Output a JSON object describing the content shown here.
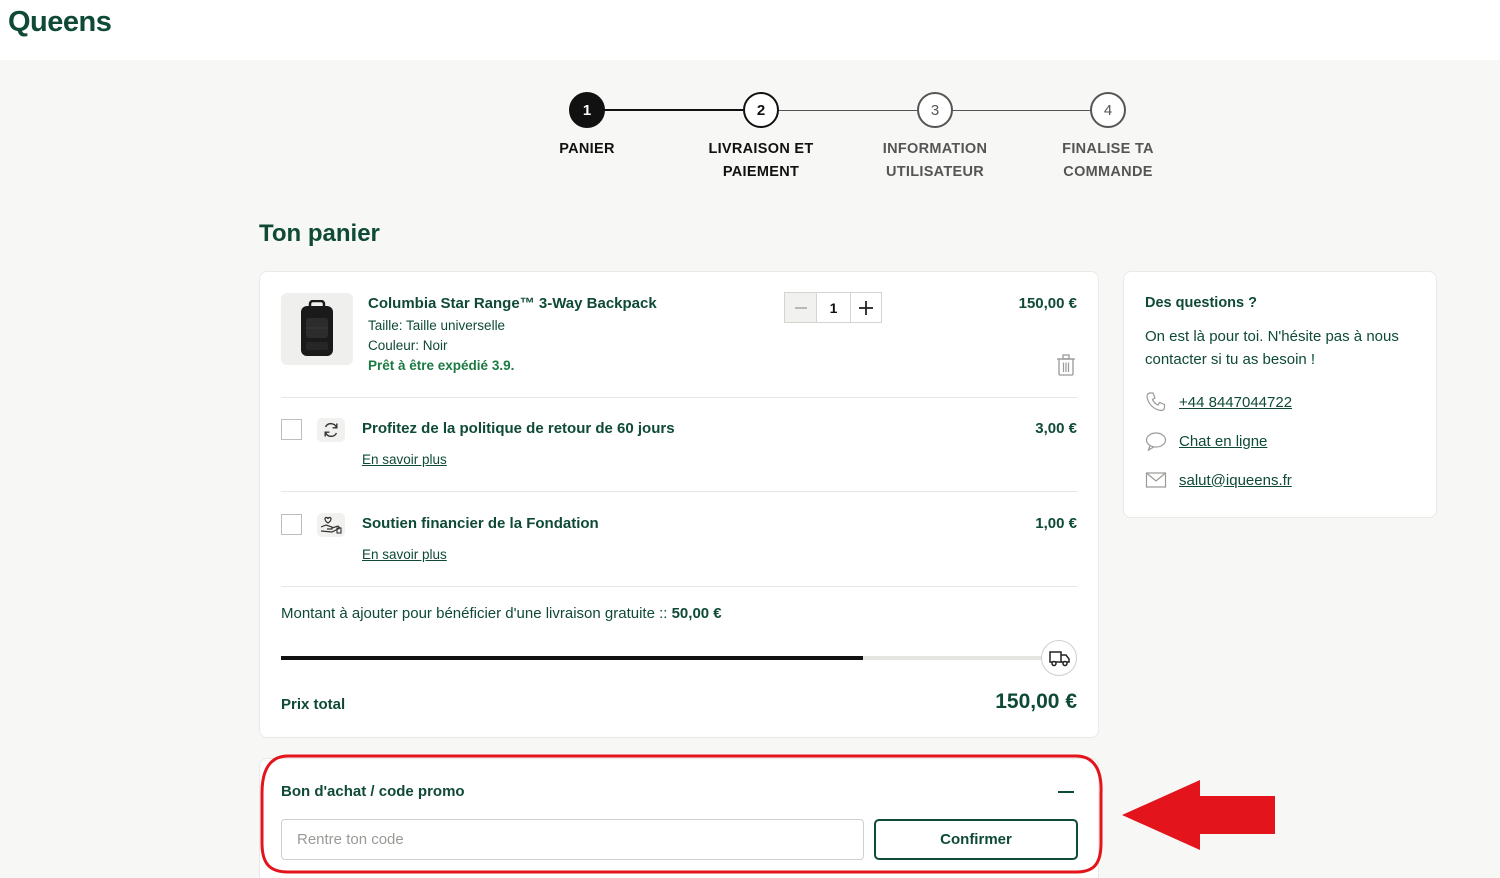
{
  "brand": {
    "logo": "Queens"
  },
  "stepper": {
    "steps": [
      {
        "number": "1",
        "line1": "PANIER",
        "line2": ""
      },
      {
        "number": "2",
        "line1": "LIVRAISON ET",
        "line2": "PAIEMENT"
      },
      {
        "number": "3",
        "line1": "INFORMATION",
        "line2": "UTILISATEUR"
      },
      {
        "number": "4",
        "line1": "FINALISE TA",
        "line2": "COMMANDE"
      }
    ],
    "active_step": 1
  },
  "cart": {
    "title": "Ton panier",
    "product": {
      "name": "Columbia Star Range™ 3-Way Backpack",
      "size": "Taille: Taille universelle",
      "color": "Couleur: Noir",
      "ready": "Prêt à être expédié 3.9.",
      "quantity": "1",
      "price": "150,00 €"
    },
    "options": [
      {
        "title": "Profitez de la politique de retour de 60 jours",
        "link": "En savoir plus",
        "price": "3,00 €",
        "icon": "refresh-icon"
      },
      {
        "title": "Soutien financier de la Fondation",
        "link": "En savoir plus",
        "price": "1,00 €",
        "icon": "donation-hand-icon"
      }
    ],
    "shipping": {
      "note": "Montant à ajouter pour bénéficier d'une livraison gratuite :: ",
      "amount": "50,00 €",
      "progress": 0.75
    },
    "total_label": "Prix total",
    "total_value": "150,00 €"
  },
  "help": {
    "title": "Des questions ?",
    "text": "On est là pour toi. N'hésite pas à nous contacter si tu as besoin !",
    "phone": "+44 8447044722",
    "chat": "Chat en ligne",
    "email": "salut@iqueens.fr"
  },
  "promo": {
    "title": "Bon d'achat / code promo",
    "placeholder": "Rentre ton code",
    "confirm": "Confirmer"
  },
  "colors": {
    "brand": "#0e4a35",
    "annotation": "#e3141b",
    "ready": "#1b7a43"
  }
}
